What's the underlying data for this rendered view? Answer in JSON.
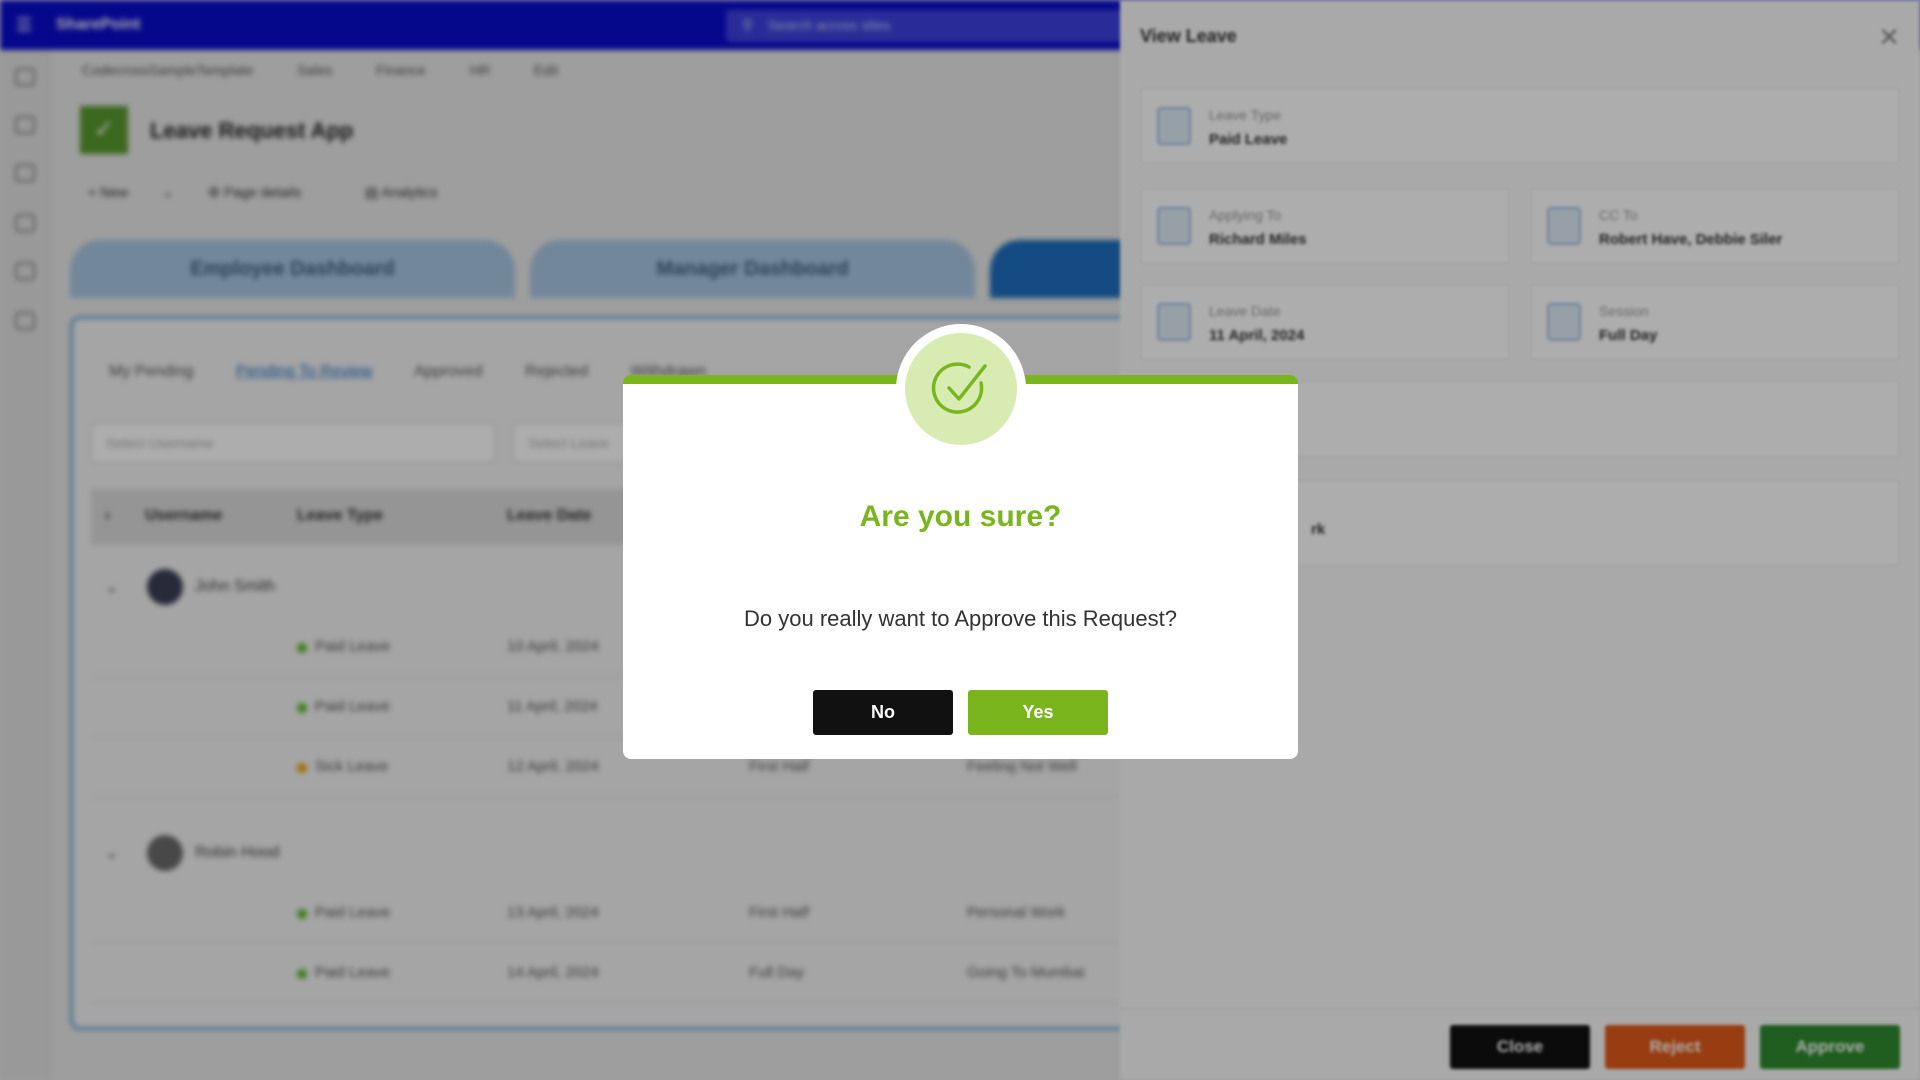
{
  "suite_bar": {
    "brand": "SharePoint",
    "search_placeholder": "Search across sites"
  },
  "site_nav": [
    "CodecrossSampleTemplate",
    "Sales",
    "Finance",
    "HR",
    "Edit"
  ],
  "app": {
    "title": "Leave Request App"
  },
  "command_bar": {
    "new": "New",
    "page_details": "Page details",
    "analytics": "Analytics"
  },
  "dashboard_tabs": [
    "Employee Dashboard",
    "Manager Dashboard"
  ],
  "sub_tabs": [
    "My Pending",
    "Pending To Review",
    "Approved",
    "Rejected",
    "Withdrawn"
  ],
  "filters": {
    "username_placeholder": "Select Username",
    "leave_placeholder": "Select Leave"
  },
  "table": {
    "headers": [
      "Username",
      "Leave Type",
      "Leave Date"
    ],
    "groups": [
      {
        "name": "John Smith",
        "rows": [
          {
            "type": "Paid Leave",
            "date": "10 April, 2024",
            "session": "",
            "reason": ""
          },
          {
            "type": "Paid Leave",
            "date": "11 April, 2024",
            "session": "",
            "reason": ""
          },
          {
            "type": "Sick Leave",
            "date": "12 April, 2024",
            "session": "First Half",
            "reason": "Feeling Not Well"
          }
        ]
      },
      {
        "name": "Robin Hood",
        "rows": [
          {
            "type": "Paid Leave",
            "date": "13 April, 2024",
            "session": "First Half",
            "reason": "Personal Work"
          },
          {
            "type": "Paid Leave",
            "date": "14 April, 2024",
            "session": "Full Day",
            "reason": "Going To Mumbai"
          }
        ]
      }
    ]
  },
  "view_leave": {
    "title": "View Leave",
    "leave_type": {
      "label": "Leave Type",
      "value": "Paid Leave"
    },
    "applying_to": {
      "label": "Applying To",
      "value": "Richard Miles"
    },
    "cc_to": {
      "label": "CC To",
      "value": "Robert Have, Debbie Siler"
    },
    "leave_date": {
      "label": "Leave Date",
      "value": "11 April, 2024"
    },
    "session": {
      "label": "Session",
      "value": "Full Day"
    },
    "partial_text": "rk",
    "buttons": {
      "close": "Close",
      "reject": "Reject",
      "approve": "Approve"
    }
  },
  "dialog": {
    "title": "Are you sure?",
    "message": "Do you really want to Approve this Request?",
    "no_label": "No",
    "yes_label": "Yes"
  },
  "colors": {
    "suite_bar": "#0a0ccf",
    "accent_green": "#7ab51d",
    "badge_bg": "#d7ebb3",
    "no_button": "#111111",
    "reject_button": "#e05a1a",
    "approve_button": "#2e8b2e",
    "close_button": "#111111",
    "dot_paid": "#5cb82a",
    "dot_sick": "#e8a300"
  },
  "icons": {
    "dialog_badge": "check-circle-icon",
    "search": "search-icon",
    "waffle": "waffle-icon",
    "panel_close": "close-icon"
  }
}
